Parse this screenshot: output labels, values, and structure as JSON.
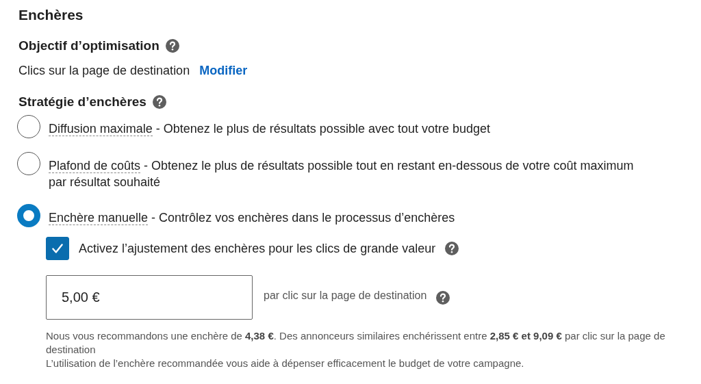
{
  "section_title": "Enchères",
  "objective": {
    "label": "Objectif d’optimisation",
    "value": "Clics sur la page de destination",
    "link": "Modifier"
  },
  "strategy": {
    "label": "Stratégie d’enchères",
    "options": [
      {
        "term": "Diffusion maximale",
        "description": " - Obtenez le plus de résultats possible avec tout votre budget",
        "selected": false
      },
      {
        "term": "Plafond de coûts",
        "description": " - Obtenez le plus de résultats possible tout en restant en-dessous de votre coût maximum par résultat souhaité",
        "selected": false
      },
      {
        "term": "Enchère manuelle",
        "description": " - Contrôlez vos enchères dans le processus d’enchères",
        "selected": true
      }
    ]
  },
  "adjustment": {
    "label": "Activez l’ajustement des enchères pour les clics de grande valeur",
    "checked": true
  },
  "bid": {
    "value": "5,00 €",
    "unit": "par clic sur la page de destination"
  },
  "help": [
    "Nous vous recommandons une enchère de **4,38 €**. Des annonceurs similaires enchérissent entre **2,85 € et 9,09 €** par clic sur la page de destination",
    "L’utilisation de l’enchère recommandée vous aide à dépenser efficacement le budget de votre campagne."
  ]
}
